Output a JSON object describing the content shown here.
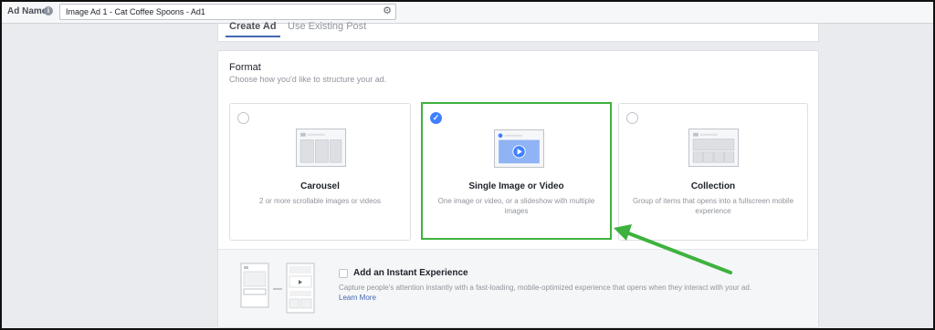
{
  "topbar": {
    "ad_name_label": "Ad Name",
    "ad_name_value": "Image Ad 1 - Cat Coffee Spoons - Ad1"
  },
  "tabs": {
    "create_ad": "Create Ad",
    "use_existing": "Use Existing Post"
  },
  "format": {
    "title": "Format",
    "subtitle": "Choose how you'd like to structure your ad.",
    "options": [
      {
        "label": "Carousel",
        "desc": "2 or more scrollable images or videos",
        "selected": false
      },
      {
        "label": "Single Image or Video",
        "desc": "One image or video, or a slideshow with multiple images",
        "selected": true
      },
      {
        "label": "Collection",
        "desc": "Group of items that opens into a fullscreen mobile experience",
        "selected": false
      }
    ]
  },
  "instant": {
    "title": "Add an Instant Experience",
    "desc": "Capture people's attention instantly with a fast-loading, mobile-optimized experience that opens when they interact with your ad.",
    "link": "Learn More"
  },
  "colors": {
    "highlight": "#3eb23e",
    "accent": "#4267b2",
    "checked": "#4080ff"
  }
}
